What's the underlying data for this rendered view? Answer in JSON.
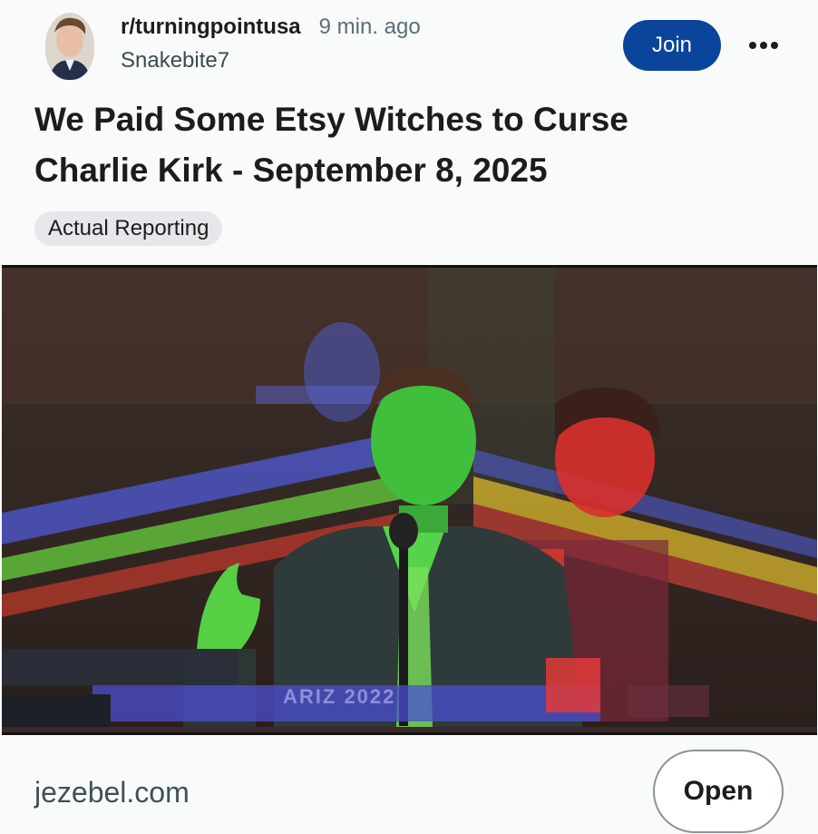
{
  "post": {
    "subreddit": "r/turningpointusa",
    "time": "9 min. ago",
    "username": "Snakebite7",
    "join_label": "Join",
    "title": "We Paid Some Etsy Witches to Curse Charlie Kirk - September 8, 2025",
    "flair": "Actual Reporting",
    "image_caption": "ARIZ 2022",
    "link_domain": "jezebel.com",
    "open_label": "Open"
  },
  "icons": {
    "more": "more-options-icon",
    "avatar": "user-avatar"
  },
  "colors": {
    "join_button": "#0a449b",
    "flair_bg": "#e5e8ea",
    "domain_text": "#3e5158"
  }
}
